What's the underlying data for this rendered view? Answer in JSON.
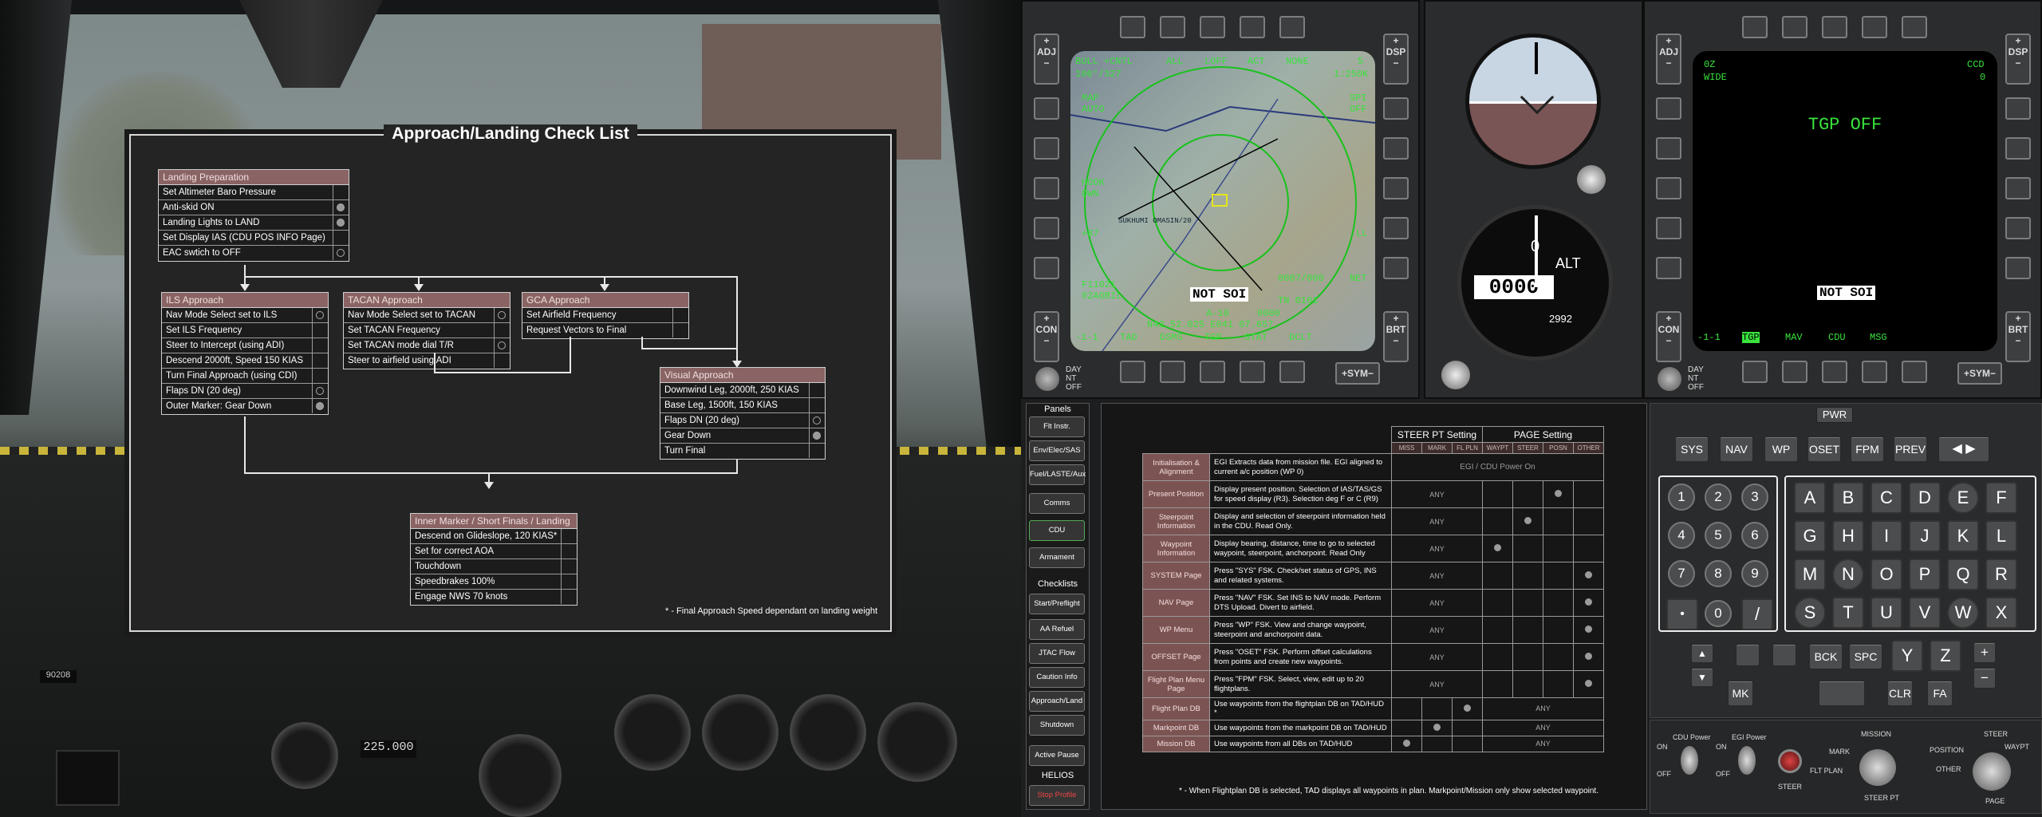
{
  "checklist": {
    "title": "Approach/Landing Check List",
    "landing_prep": {
      "header": "Landing Preparation",
      "items": [
        "Set Altimeter Baro Pressure",
        "Anti-skid ON",
        "Landing Lights to LAND",
        "Set Display IAS (CDU POS INFO Page)",
        "EAC swtich to OFF"
      ]
    },
    "ils": {
      "header": "ILS Approach",
      "items": [
        "Nav Mode Select set to ILS",
        "Set ILS Frequency",
        "Steer to Intercept (using ADI)",
        "Descend 2000ft, Speed 150 KIAS",
        "Turn Final Approach (using CDI)",
        "Flaps DN (20 deg)",
        "Outer Marker: Gear Down"
      ]
    },
    "tacan": {
      "header": "TACAN Approach",
      "items": [
        "Nav Mode Select set to TACAN",
        "Set TACAN Frequency",
        "Set TACAN mode dial T/R",
        "Steer to airfield using ADI"
      ]
    },
    "gca": {
      "header": "GCA Approach",
      "items": [
        "Set Airfield Frequency",
        "Request Vectors to Final"
      ]
    },
    "visual": {
      "header": "Visual Approach",
      "items": [
        "Downwind Leg, 2000ft, 250 KIAS",
        "Base Leg, 1500ft, 150 KIAS",
        "Flaps DN (20 deg)",
        "Gear Down",
        "Turn Final"
      ]
    },
    "inner": {
      "header": "Inner Marker / Short Finals / Landing",
      "items": [
        "Descend on Glideslope, 120 KIAS*",
        "Set for correct AOA",
        "Touchdown",
        "Speedbrakes 100%",
        "Engage NWS 70 knots"
      ]
    },
    "footnote": "* - Final Approach Speed dependant on landing weight"
  },
  "cockpit": {
    "altimeter_readout": "225.000",
    "tail_number": "90208"
  },
  "mfd_left": {
    "top_labels": [
      "BULL",
      "+CNTL",
      "ALL",
      "LOFF",
      "ACT",
      "NONE",
      "5"
    ],
    "left_labels": [
      "106°/327",
      "MAP",
      "AUTO",
      "HOOK",
      "OWN",
      "+87",
      "F11021",
      "02AGBIL"
    ],
    "right_labels": [
      "1:250K",
      "SPI",
      "OFF",
      "LL",
      "NET"
    ],
    "bottom_labels": [
      "-1-1",
      "TAD",
      "DSMS",
      "TGP",
      "STAT",
      "DCLT"
    ],
    "info_lines": [
      "A-10",
      "N42 52.025 E041 07.657",
      "0000",
      "0007/000",
      "TN 0101"
    ],
    "map_label": "SUKHUMI OMASIN/20",
    "notsoi": "NOT SOI",
    "adj": "ADJ",
    "dsp": "DSP",
    "con": "CON",
    "brt": "BRT",
    "sym": "SYM",
    "day_nt_off": [
      "DAY",
      "NT",
      "OFF"
    ]
  },
  "mfd_right": {
    "top_left": [
      "0Z",
      "WIDE"
    ],
    "top_right": [
      "CCD",
      "0"
    ],
    "main": "TGP OFF",
    "bottom_labels": [
      "-1-1",
      "TGP",
      "MAV",
      "CDU",
      "MSG"
    ],
    "notsoi": "NOT SOI",
    "adj": "ADJ",
    "dsp": "DSP",
    "con": "CON",
    "brt": "BRT",
    "sym": "SYM",
    "day_nt_off": [
      "DAY",
      "NT",
      "OFF"
    ]
  },
  "altimeter": {
    "label": "ALT",
    "readout": "0000",
    "small": "2992"
  },
  "panels": {
    "header": "Panels",
    "items": [
      "Flt Instr.",
      "Env/Elec/SAS",
      "Fuel/LASTE/Aux",
      "Comms",
      "CDU",
      "Armament"
    ],
    "checklists_header": "Checklists",
    "checklists": [
      "Start/Preflight",
      "AA Refuel",
      "JTAC Flow",
      "Caution Info",
      "Approach/Land",
      "Shutdown"
    ],
    "active_pause": "Active Pause",
    "helios_header": "HELIOS",
    "stop_profile": "Stop Profile"
  },
  "steer_table": {
    "group_steer": "STEER PT Setting",
    "group_page": "PAGE Setting",
    "sub_headers": [
      "MISS",
      "MARK",
      "FL PLN",
      "WAYPT",
      "STEER",
      "POSN",
      "OTHER"
    ],
    "egi_note": "EGI / CDU Power On",
    "any": "ANY",
    "rows": [
      {
        "name": "Initialisation & Alignment",
        "desc": "EGI Extracts data from mission file. EGI aligned to current a/c position (WP 0)"
      },
      {
        "name": "Present Position",
        "desc": "Display present position. Selection of IAS/TAS/GS for speed display (R3). Selection deg F or C (R9)"
      },
      {
        "name": "Steerpoint Information",
        "desc": "Display and selection of steerpoint information held in the CDU. Read Only."
      },
      {
        "name": "Waypoint Information",
        "desc": "Display bearing, distance, time to go to selected waypoint, steerpoint, anchorpoint. Read Only"
      },
      {
        "name": "SYSTEM Page",
        "desc": "Press \"SYS\" FSK. Check/set status of GPS, INS and related systems."
      },
      {
        "name": "NAV Page",
        "desc": "Press \"NAV\" FSK. Set INS to NAV mode. Perform DTS Upload. Divert to airfield."
      },
      {
        "name": "WP Menu",
        "desc": "Press \"WP\" FSK. View and change waypoint, steerpoint and anchorpoint data."
      },
      {
        "name": "OFFSET Page",
        "desc": "Press \"OSET\" FSK. Perform offset calculations from points and create new waypoints."
      },
      {
        "name": "Flight Plan Menu Page",
        "desc": "Press \"FPM\" FSK. Select, view, edit up to 20 flightplans."
      },
      {
        "name": "Flight Plan DB",
        "desc": "Use waypoints from the flightplan DB on TAD/HUD *"
      },
      {
        "name": "Markpoint DB",
        "desc": "Use waypoints from the markpoint DB on TAD/HUD"
      },
      {
        "name": "Mission DB",
        "desc": "Use waypoints from all DBs on TAD/HUD"
      }
    ],
    "footnote": "* - When Flightplan DB is selected, TAD displays all waypoints in plan. Markpoint/Mission only show selected waypoint."
  },
  "cdu": {
    "pwr": "PWR",
    "fkeys": [
      "SYS",
      "NAV",
      "WP",
      "OSET",
      "FPM",
      "PREV"
    ],
    "numbers": [
      "1",
      "2",
      "3",
      "4",
      "5",
      "6",
      "7",
      "8",
      "9",
      "•",
      "0",
      "/"
    ],
    "letters": [
      "A",
      "B",
      "C",
      "D",
      "E",
      "F",
      "G",
      "H",
      "I",
      "J",
      "K",
      "L",
      "M",
      "N",
      "O",
      "P",
      "Q",
      "R",
      "S",
      "T",
      "U",
      "V",
      "W",
      "X"
    ],
    "bottom_keys": [
      "BCK",
      "SPC",
      "Y",
      "Z",
      "MK",
      "CLR",
      "FA"
    ],
    "plus": "+",
    "minus": "−",
    "switch_labels": {
      "cdu_power": "CDU Power",
      "egi_power": "EGI Power",
      "on": "ON",
      "off": "OFF",
      "steer": "STEER",
      "mission": "MISSION",
      "mark": "MARK",
      "flt_plan": "FLT PLAN",
      "steer_pt": "STEER PT",
      "steer_top": "STEER",
      "position": "POSITION",
      "waypt": "WAYPT",
      "other": "OTHER",
      "page": "PAGE"
    }
  },
  "colors": {
    "mfd_green": "#39e23c",
    "header_red": "#8a6464",
    "background": "#242424"
  }
}
